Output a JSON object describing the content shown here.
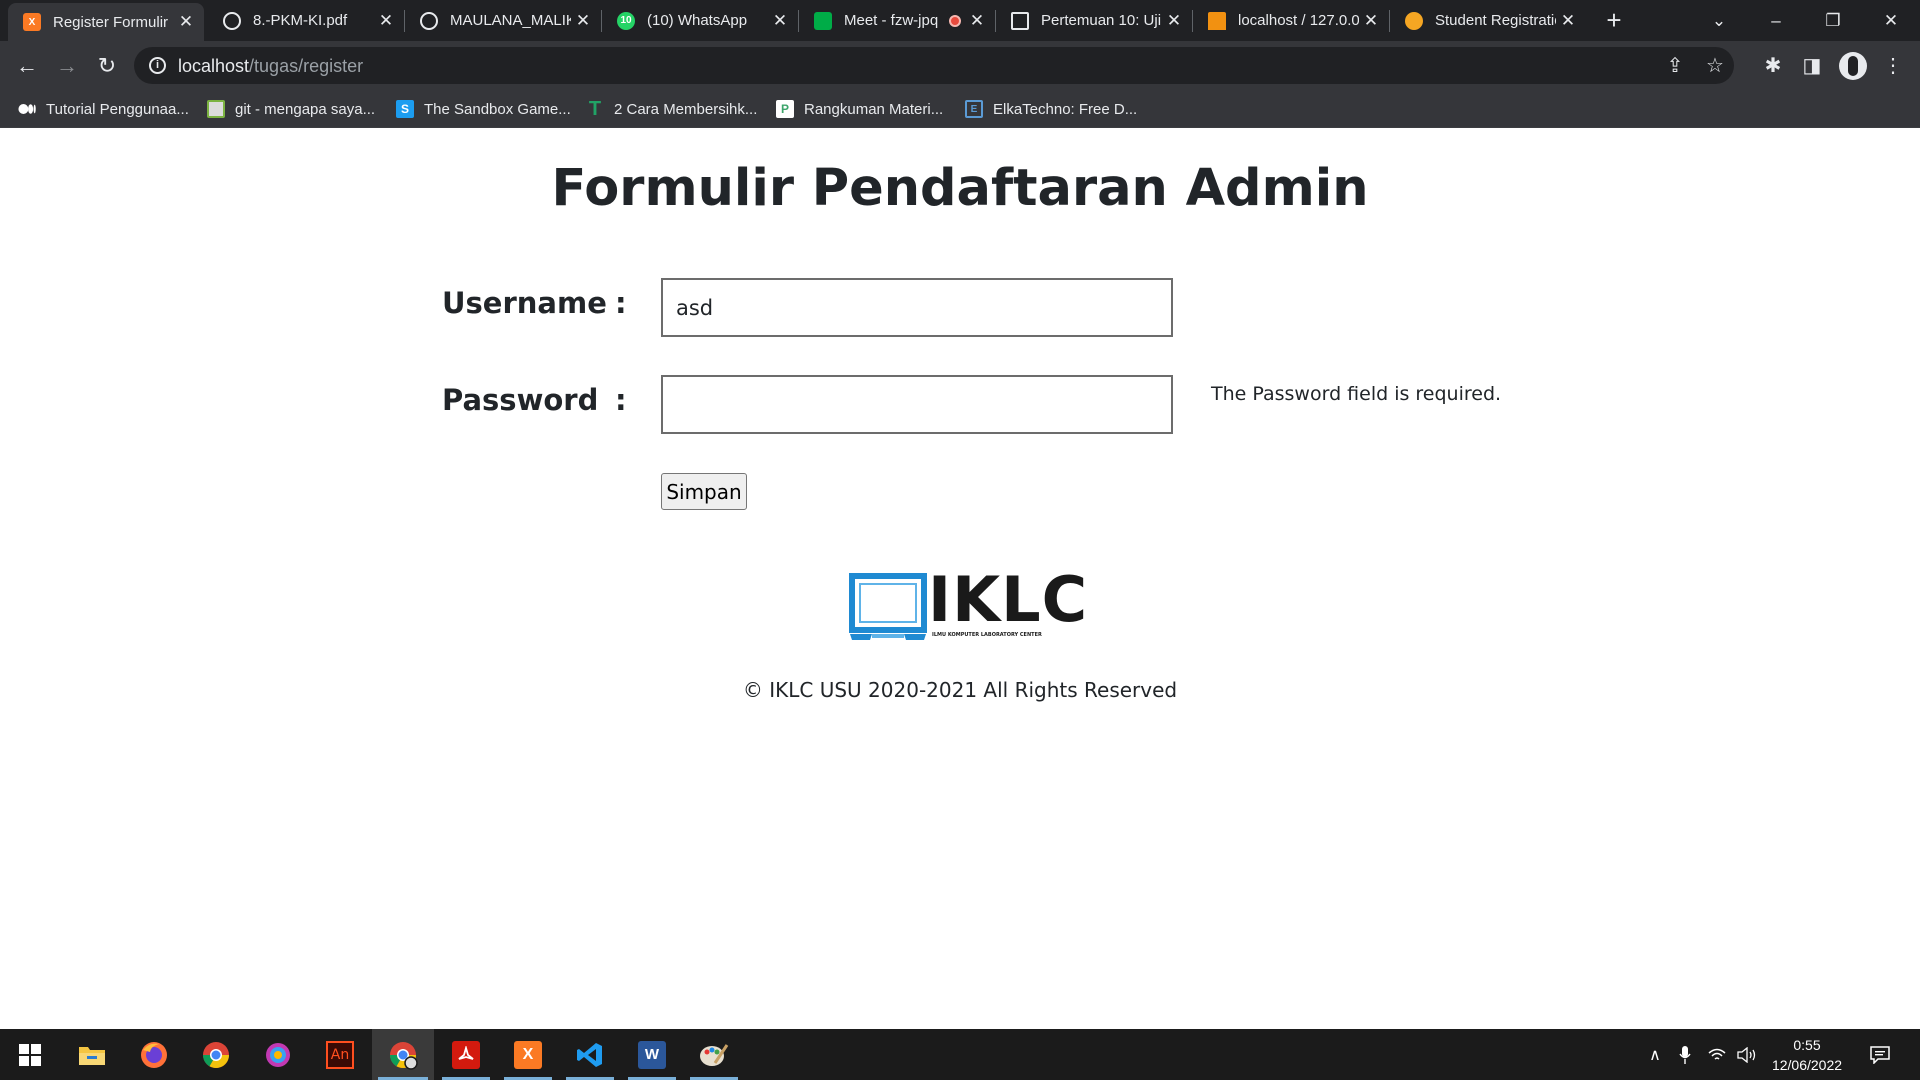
{
  "browser": {
    "tabs": [
      {
        "title": "Register Formulir",
        "icon": "xampp-icon",
        "color": "#fb7a24",
        "active": true
      },
      {
        "title": "8.-PKM-KI.pdf",
        "icon": "globe-icon",
        "color": "#e8eaed"
      },
      {
        "title": "MAULANA_MALIK",
        "icon": "globe-icon",
        "color": "#e8eaed"
      },
      {
        "title": "(10) WhatsApp",
        "icon": "whatsapp-icon",
        "color": "#25d366",
        "badge": "10"
      },
      {
        "title": "Meet - fzw-jpq",
        "icon": "meet-icon",
        "color": "#00ac47",
        "recording": true
      },
      {
        "title": "Pertemuan 10: Uji",
        "icon": "classroom-icon",
        "color": "#e8eaed"
      },
      {
        "title": "localhost / 127.0.0",
        "icon": "phpmyadmin-icon",
        "color": "#f29111"
      },
      {
        "title": "Student Registration",
        "icon": "moodle-icon",
        "color": "#f5a623"
      }
    ],
    "new_tab": "+",
    "window_controls": {
      "minimize": "–",
      "restore": "❐",
      "close": "✕",
      "tab_search": "⌄"
    },
    "nav": {
      "back": "←",
      "forward": "→",
      "reload": "↻"
    },
    "url": {
      "host": "localhost",
      "path": "/tugas/register"
    },
    "bookmarks": [
      {
        "label": "Tutorial Penggunaa...",
        "icon": "medium-icon",
        "color": "#ffffff"
      },
      {
        "label": "git - mengapa saya...",
        "icon": "page-icon",
        "color": "#dcdcdc"
      },
      {
        "label": "The Sandbox Game...",
        "icon": "sandbox-icon",
        "color": "#1c9df0",
        "glyph": "S"
      },
      {
        "label": "2 Cara Membersihk...",
        "icon": "t-icon",
        "color": "#21a366",
        "glyph": "T"
      },
      {
        "label": "Rangkuman Materi...",
        "icon": "doc-icon",
        "color": "#3da56b",
        "glyph": "P"
      },
      {
        "label": "ElkaTechno: Free D...",
        "icon": "book-icon",
        "color": "#5b9bd5",
        "glyph": "E"
      }
    ]
  },
  "page": {
    "title": "Formulir Pendaftaran Admin",
    "username_label": "Username",
    "password_label": "Password",
    "colon": ":",
    "username_value": "asd",
    "password_value": "",
    "password_error": "The Password field is required.",
    "submit_label": "Simpan",
    "logo_text": "IKLC",
    "logo_subtext": "ILMU KOMPUTER LABORATORY CENTER",
    "footer": "© IKLC USU 2020-2021 All Rights Reserved"
  },
  "taskbar": {
    "apps": [
      "windows-start-icon",
      "file-explorer-icon",
      "firefox-icon",
      "chrome-icon",
      "paint-3d-icon",
      "animate-icon",
      "chrome-profile-icon",
      "acrobat-icon",
      "xampp-icon",
      "vscode-icon",
      "word-icon",
      "paint-icon"
    ],
    "animate_label": "An",
    "word_label": "W",
    "clock_time": "0:55",
    "clock_date": "12/06/2022"
  },
  "colors": {
    "accent": "#1f8ad2",
    "tabstrip": "#202124",
    "toolbar": "#35363a"
  }
}
